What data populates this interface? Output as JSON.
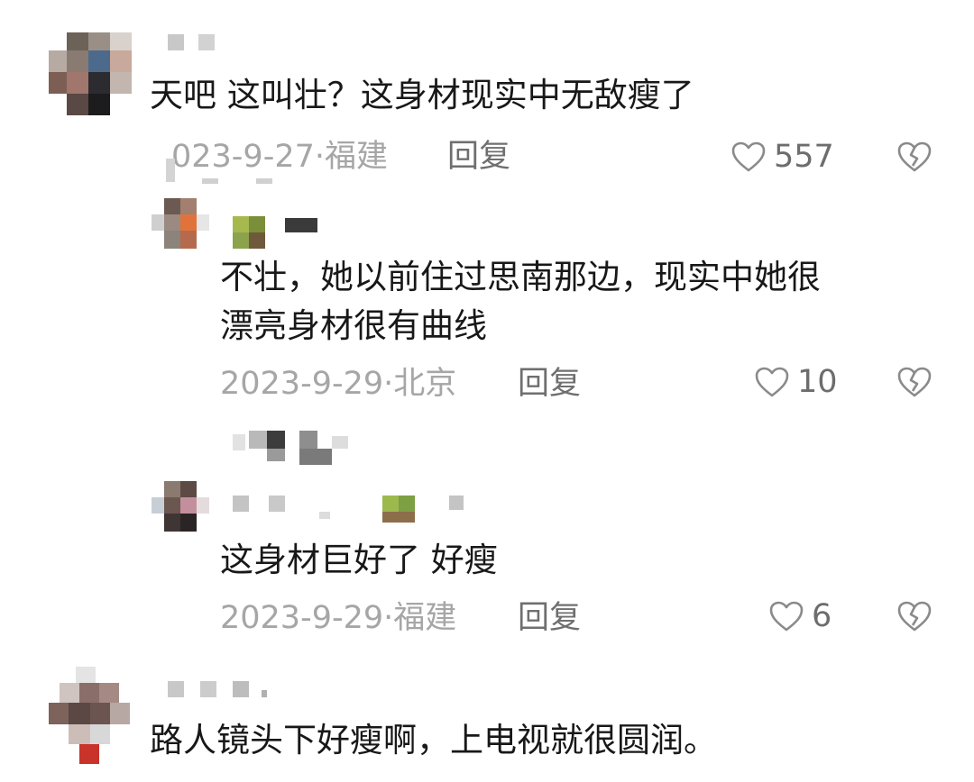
{
  "comments": [
    {
      "text": "天吧  这叫壮？这身材现实中无敌瘦了",
      "date": "023-9-27",
      "location": "福建",
      "reply_label": "回复",
      "likes": "557"
    },
    {
      "text_line1": "不壮，她以前住过思南那边，现实中她很",
      "text_line2": "漂亮身材很有曲线",
      "date": "2023-9-29",
      "location": "北京",
      "reply_label": "回复",
      "likes": "10"
    },
    {
      "text": "这身材巨好了  好瘦",
      "date": "2023-9-29",
      "location": "福建",
      "reply_label": "回复",
      "likes": "6"
    },
    {
      "text": "路人镜头下好瘦啊，上电视就很圆润。"
    }
  ],
  "separator": "·",
  "colors": {
    "text": "#181818",
    "meta": "#a6a6a6",
    "icon": "#8a8a8a"
  },
  "icons": {
    "like": "heart-outline-icon",
    "dislike": "broken-heart-icon"
  }
}
